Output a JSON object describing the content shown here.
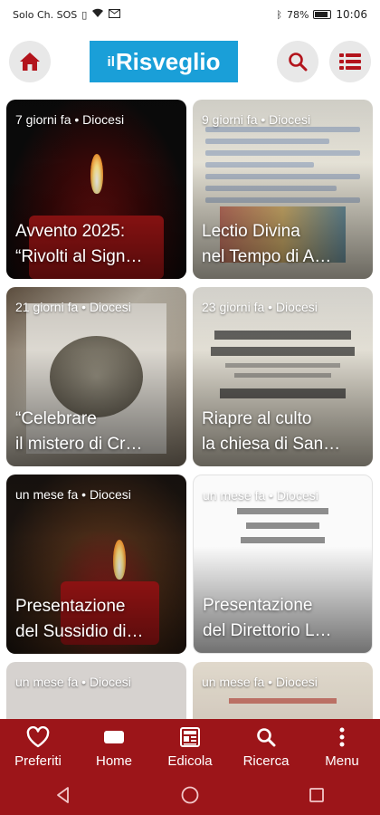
{
  "status": {
    "carrier": "Solo Ch. SOS",
    "battery": "78%",
    "time": "10:06"
  },
  "header": {
    "logo_prefix": "il",
    "logo_name": "Risveglio"
  },
  "articles": [
    {
      "meta": "7 giorni fa • Diocesi",
      "title_line1": "Avvento 2025:",
      "title_line2": "“Rivolti al Sign…"
    },
    {
      "meta": "9 giorni fa • Diocesi",
      "title_line1": "Lectio Divina",
      "title_line2": "nel Tempo di A…"
    },
    {
      "meta": "21 giorni fa • Diocesi",
      "title_line1": "“Celebrare",
      "title_line2": "il mistero di Cr…"
    },
    {
      "meta": "23 giorni fa • Diocesi",
      "title_line1": "Riapre al culto",
      "title_line2": "la chiesa di San…"
    },
    {
      "meta": "un mese fa • Diocesi",
      "title_line1": "Presentazione",
      "title_line2": "del Sussidio di…"
    },
    {
      "meta": "un mese fa • Diocesi",
      "title_line1": "Presentazione",
      "title_line2": "del Direttorio L…"
    },
    {
      "meta": "un mese fa • Diocesi"
    },
    {
      "meta": "un mese fa • Diocesi"
    }
  ],
  "nav": {
    "items": [
      {
        "label": "Preferiti",
        "icon": "heart-icon"
      },
      {
        "label": "Home",
        "icon": "home-card-icon"
      },
      {
        "label": "Edicola",
        "icon": "newspaper-icon"
      },
      {
        "label": "Ricerca",
        "icon": "search-icon"
      },
      {
        "label": "Menu",
        "icon": "more-vertical-icon"
      }
    ]
  },
  "colors": {
    "brand_blue": "#1a9fd8",
    "nav_red": "#9c1519",
    "icon_red": "#b3141c"
  }
}
